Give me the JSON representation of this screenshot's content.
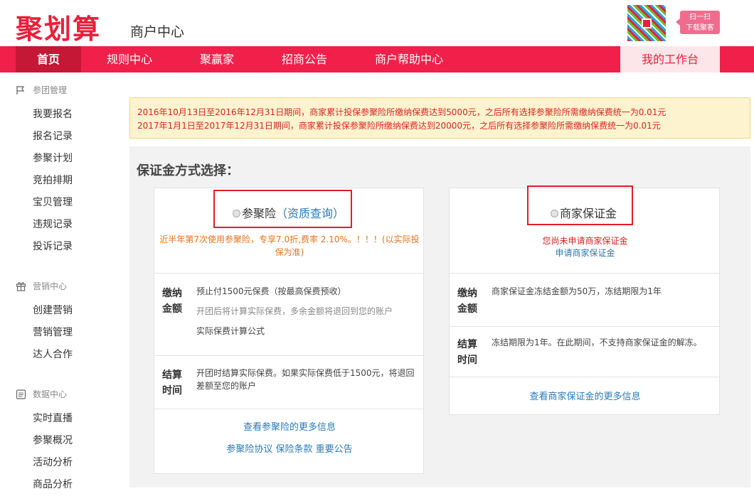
{
  "header": {
    "logo": "聚划算",
    "subtitle": "商户中心",
    "scan_line1": "扫一扫",
    "scan_line2": "下载聚客"
  },
  "nav": {
    "items": [
      "首页",
      "规则中心",
      "聚赢家",
      "招商公告",
      "商户帮助中心"
    ],
    "workbench": "我的工作台"
  },
  "sidebar": {
    "groups": [
      {
        "title": "参团管理",
        "icon": "flag-icon",
        "items": [
          "我要报名",
          "报名记录",
          "参聚计划",
          "竞拍排期",
          "宝贝管理",
          "违规记录",
          "投诉记录"
        ]
      },
      {
        "title": "营销中心",
        "icon": "gift-icon",
        "items": [
          "创建营销",
          "营销管理",
          "达人合作"
        ]
      },
      {
        "title": "数据中心",
        "icon": "document-icon",
        "items": [
          "实时直播",
          "参聚概况",
          "活动分析",
          "商品分析"
        ]
      }
    ]
  },
  "notice": {
    "line1": "2016年10月13日至2016年12月31日期间，商家累计投保参聚险所缴纳保费达到5000元，之后所有选择参聚险所需缴纳保费统一为0.01元",
    "line2": "2017年1月1日至2017年12月31日期间，商家累计投保参聚险所缴纳保费达到20000元，之后所有选择参聚险所需缴纳保费统一为0.01元"
  },
  "panel": {
    "title": "保证金方式选择："
  },
  "insurance": {
    "option_label": "参聚险",
    "paren_open": "（",
    "query_link": "资质查询",
    "paren_close": "）",
    "promo": "近半年第7次使用参聚险，专享7.0折,费率 2.10%。！！！(以实际投保为准)",
    "pay_label_1": "缴纳",
    "pay_label_2": "金额",
    "pay_line1": "预止付1500元保费（按最高保费预收）",
    "pay_line2": "开团后将计算实际保费，多余金额将退回到您的账户",
    "formula_link": "实际保费计算公式",
    "settle_label_1": "结算",
    "settle_label_2": "时间",
    "settle_line1": "开团时结算实际保费。如果实际保费低于1500元，将退回",
    "settle_line2": "差额至您的账户",
    "more_link": "查看参聚险的更多信息",
    "agreement_link": "参聚险协议",
    "terms_link": "保险条款",
    "announce_link": "重要公告"
  },
  "deposit": {
    "option_label": "商家保证金",
    "not_applied": "您尚未申请商家保证金",
    "apply_link": "申请商家保证金",
    "pay_label_1": "缴纳",
    "pay_label_2": "金额",
    "pay_text": "商家保证金冻结金额为50万，冻结期限为1年",
    "settle_label_1": "结算",
    "settle_label_2": "时间",
    "settle_text": "冻结期限为1年。在此期间，不支持商家保证金的解冻。",
    "more_link": "查看商家保证金的更多信息"
  }
}
